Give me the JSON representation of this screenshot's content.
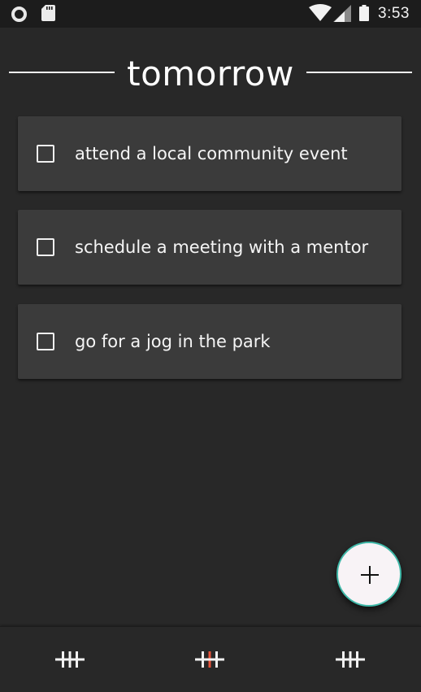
{
  "status_bar": {
    "time": "3:53",
    "icons": [
      "circle-notification-icon",
      "sd-card-icon",
      "wifi-icon",
      "cell-signal-icon",
      "battery-icon"
    ]
  },
  "header": {
    "title": "tomorrow"
  },
  "tasks": [
    {
      "text": "attend a local community event",
      "checked": false
    },
    {
      "text": "schedule a meeting with a mentor",
      "checked": false
    },
    {
      "text": "go for a jog in the park",
      "checked": false
    }
  ],
  "fab": {
    "icon": "plus-icon"
  },
  "bottom_nav": {
    "items": [
      {
        "icon": "tally-icon",
        "active": false
      },
      {
        "icon": "tally-icon",
        "active": true
      },
      {
        "icon": "tally-icon",
        "active": false
      }
    ]
  },
  "colors": {
    "background": "#282828",
    "card": "#3b3b3b",
    "fab_border": "#3fb8a8",
    "accent": "#e8533a"
  }
}
